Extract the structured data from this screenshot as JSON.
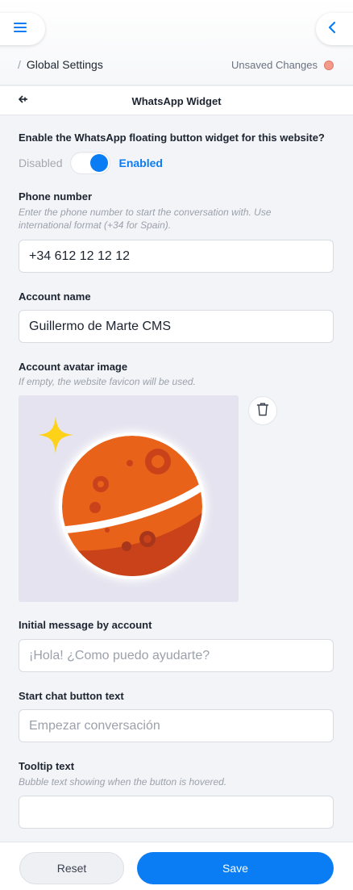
{
  "header": {
    "breadcrumb_sep": "/",
    "breadcrumb": "Global Settings",
    "status_text": "Unsaved Changes",
    "status_color": "#f39a8a"
  },
  "subheader": {
    "title": "WhatsApp Widget",
    "back_icon": "arrow-left-icon"
  },
  "form": {
    "enable": {
      "label": "Enable the WhatsApp floating button widget for this website?",
      "off_label": "Disabled",
      "on_label": "Enabled",
      "state": "on"
    },
    "phone": {
      "label": "Phone number",
      "hint": "Enter the phone number to start the conversation with. Use international format (+34 for Spain).",
      "value": "+34 612 12 12 12"
    },
    "account_name": {
      "label": "Account name",
      "value": "Guillermo de Marte CMS"
    },
    "avatar": {
      "label": "Account avatar image",
      "hint": "If empty, the website favicon will be used.",
      "image_icon": "planet-with-star-icon",
      "delete_icon": "trash-icon"
    },
    "initial_message": {
      "label": "Initial message by account",
      "placeholder": "¡Hola! ¿Como puedo ayudarte?",
      "value": ""
    },
    "start_chat": {
      "label": "Start chat button text",
      "placeholder": "Empezar conversación",
      "value": ""
    },
    "tooltip": {
      "label": "Tooltip text",
      "hint": "Bubble text showing when the button is hovered.",
      "value": ""
    }
  },
  "footer": {
    "reset_label": "Reset",
    "save_label": "Save"
  },
  "colors": {
    "accent": "#0a7cf4",
    "background": "#f3f4f8",
    "planet": "#e8621a"
  }
}
